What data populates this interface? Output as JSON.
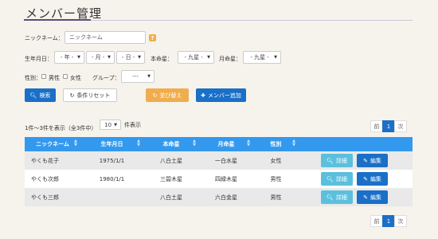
{
  "page_title": "メンバー管理",
  "form": {
    "nickname_label": "ニックネーム：",
    "nickname_placeholder": "ニックネーム",
    "help": "?",
    "birth_label": "生年月日：",
    "year": "- 年 -",
    "month": "- 月 -",
    "day": "- 日 -",
    "honmei_label": "本命星：",
    "honmei_value": "- 九星 -",
    "getsumei_label": "月命星：",
    "getsumei_value": "- 九星 -",
    "gender_label": "性別：",
    "gender_male": "男性",
    "gender_female": "女性",
    "group_label": "グループ：",
    "group_value": "---"
  },
  "buttons": {
    "search": "検索",
    "reset": "条件リセット",
    "sort": "並び替え",
    "add": "メンバー追加",
    "detail": "詳細",
    "edit": "編集"
  },
  "list_info": {
    "summary": "1件～3件を表示（全3件中）",
    "per_page": "10",
    "per_page_suffix": "件表示"
  },
  "pager": {
    "prev": "前",
    "page": "1",
    "next": "次"
  },
  "table": {
    "headers": [
      "ニックネーム",
      "生年月日",
      "本命星",
      "月命星",
      "性別"
    ],
    "rows": [
      {
        "name": "やくも花子",
        "birth": "1975/1/1",
        "honmei": "八白土星",
        "getsumei": "一白水星",
        "gender": "女性"
      },
      {
        "name": "やくも次郎",
        "birth": "1980/1/1",
        "honmei": "三碧木星",
        "getsumei": "四緑木星",
        "gender": "男性"
      },
      {
        "name": "やくも三郎",
        "birth": "",
        "honmei": "八白土星",
        "getsumei": "六白金星",
        "gender": "男性"
      }
    ]
  },
  "colors": {
    "primary": "#1a6fc7",
    "table_header": "#3399ee",
    "orange": "#f0ad4e",
    "cyan": "#5bc0de",
    "title_rule": "#5b4a7a"
  }
}
